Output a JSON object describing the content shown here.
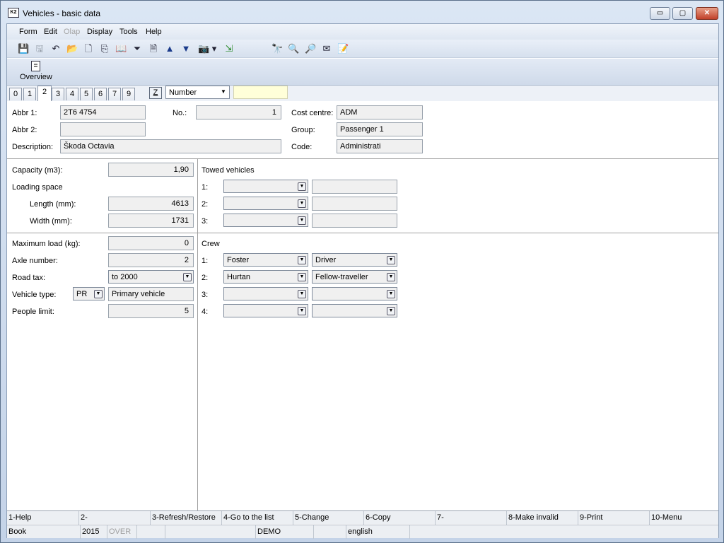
{
  "window": {
    "title": "Vehicles - basic data",
    "app_icon_text": "K2",
    "min_glyph": "▭",
    "max_glyph": "▢",
    "close_glyph": "✕"
  },
  "menu": {
    "items": [
      {
        "label": "Form",
        "disabled": false
      },
      {
        "label": "Edit",
        "disabled": false
      },
      {
        "label": "Olap",
        "disabled": true
      },
      {
        "label": "Display",
        "disabled": false
      },
      {
        "label": "Tools",
        "disabled": false
      },
      {
        "label": "Help",
        "disabled": false
      }
    ]
  },
  "toolbar": {
    "icons": [
      {
        "name": "save-icon",
        "glyph": "💾",
        "grey": true
      },
      {
        "name": "save-as-icon",
        "glyph": "🖫",
        "grey": true
      },
      {
        "name": "undo-icon",
        "glyph": "↶",
        "grey": false
      },
      {
        "name": "open-folder-icon",
        "glyph": "📂",
        "grey": false
      },
      {
        "name": "new-document-icon",
        "glyph": "🗋",
        "grey": false
      },
      {
        "name": "copy-icon",
        "glyph": "⎘",
        "grey": false
      },
      {
        "name": "book-icon",
        "glyph": "📖",
        "grey": false
      },
      {
        "name": "filter-icon",
        "glyph": "⏷",
        "grey": false
      },
      {
        "name": "document-filter-icon",
        "glyph": "🗎",
        "grey": false
      },
      {
        "name": "arrow-up-icon",
        "glyph": "▲",
        "grey": false
      },
      {
        "name": "arrow-down-icon",
        "glyph": "▼",
        "grey": false
      },
      {
        "name": "camera-icon",
        "glyph": "📷",
        "grey": false
      },
      {
        "name": "dropdown-arrow-icon",
        "glyph": "▾",
        "grey": false
      },
      {
        "name": "export-icon",
        "glyph": "⇲",
        "grey": false
      },
      {
        "name": "binoculars-icon",
        "glyph": "🔭",
        "grey": false
      },
      {
        "name": "binoculars-next-icon",
        "glyph": "🔍",
        "grey": false
      },
      {
        "name": "binoculars-settings-icon",
        "glyph": "🔎",
        "grey": false
      },
      {
        "name": "mail-icon",
        "glyph": "✉",
        "grey": false
      },
      {
        "name": "notes-icon",
        "glyph": "📝",
        "grey": false
      }
    ],
    "overview_label": "Overview",
    "overview_glyph": "≣"
  },
  "tabs": {
    "items": [
      "0",
      "1",
      "2",
      "3",
      "4",
      "5",
      "6",
      "7",
      "9"
    ],
    "active": "2",
    "z_button": "Z",
    "sort_combo": "Number",
    "arrow_glyph": "▼"
  },
  "header": {
    "abbr1_label": "Abbr 1:",
    "abbr1_value": "2T6 4754",
    "abbr2_label": "Abbr 2:",
    "abbr2_value": "",
    "description_label": "Description:",
    "description_value": "Škoda Octavia",
    "no_label": "No.:",
    "no_value": "1",
    "cost_centre_label": "Cost centre:",
    "cost_centre_value": "ADM",
    "group_label": "Group:",
    "group_value": "Passenger 1",
    "code_label": "Code:",
    "code_value": "Administrati"
  },
  "dimensions": {
    "capacity_label": "Capacity (m3):",
    "capacity_value": "1,90",
    "loading_space_label": "Loading space",
    "length_label": "Length (mm):",
    "length_value": "4613",
    "width_label": "Width (mm):",
    "width_value": "1731"
  },
  "towed": {
    "title": "Towed vehicles",
    "rows": [
      {
        "label": "1:",
        "combo": "",
        "value": ""
      },
      {
        "label": "2:",
        "combo": "",
        "value": ""
      },
      {
        "label": "3:",
        "combo": "",
        "value": ""
      }
    ]
  },
  "details": {
    "max_load_label": "Maximum load (kg):",
    "max_load_value": "0",
    "axle_label": "Axle number:",
    "axle_value": "2",
    "road_tax_label": "Road tax:",
    "road_tax_value": "to 2000",
    "vehicle_type_label": "Vehicle type:",
    "vehicle_type_code": "PR",
    "vehicle_type_value": "Primary vehicle",
    "people_limit_label": "People limit:",
    "people_limit_value": "5"
  },
  "crew": {
    "title": "Crew",
    "rows": [
      {
        "label": "1:",
        "person": "Foster",
        "role": "Driver"
      },
      {
        "label": "2:",
        "person": "Hurtan",
        "role": "Fellow-traveller"
      },
      {
        "label": "3:",
        "person": "",
        "role": ""
      },
      {
        "label": "4:",
        "person": "",
        "role": ""
      }
    ]
  },
  "fkeys": [
    "1-Help",
    "2-",
    "3-Refresh/Restore",
    "4-Go to the list",
    "5-Change",
    "6-Copy",
    "7-",
    "8-Make invalid",
    "9-Print",
    "10-Menu"
  ],
  "status": {
    "cells": [
      {
        "text": "Book",
        "dim": false
      },
      {
        "text": "2015",
        "dim": false
      },
      {
        "text": "OVER",
        "dim": true
      },
      {
        "text": "",
        "dim": false
      },
      {
        "text": "",
        "dim": false
      },
      {
        "text": "DEMO",
        "dim": false
      },
      {
        "text": "",
        "dim": false
      },
      {
        "text": "english",
        "dim": false
      },
      {
        "text": "",
        "dim": false
      }
    ]
  }
}
